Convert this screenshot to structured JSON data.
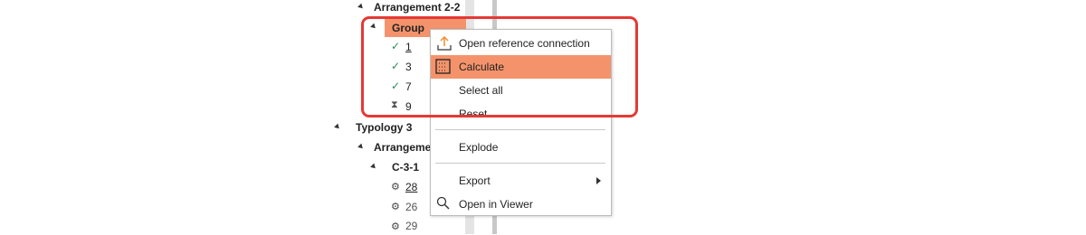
{
  "tree": {
    "arrangement_2_2": "Arrangement 2-2",
    "group": "Group",
    "items": [
      {
        "status": "check",
        "label": "1"
      },
      {
        "status": "check",
        "label": "3"
      },
      {
        "status": "check",
        "label": "7"
      },
      {
        "status": "hourglass",
        "label": "9"
      }
    ],
    "typology_3": "Typology 3",
    "arrangement_3_truncated": "Arrangemen",
    "c_3_1": "C-3-1",
    "sub_items": [
      {
        "status": "gear",
        "label": "28"
      },
      {
        "status": "gear",
        "label": "26"
      },
      {
        "status": "gear",
        "label": "29"
      }
    ]
  },
  "context_menu": {
    "open_reference_connection": "Open reference connection",
    "calculate": "Calculate",
    "select_all": "Select all",
    "reset": "Reset",
    "explode": "Explode",
    "export": "Export",
    "open_in_viewer": "Open in Viewer"
  },
  "colors": {
    "highlight": "#f4936b",
    "annotation_frame": "#e53935",
    "check": "#2e8b57"
  },
  "icons": {
    "open_reference_connection": "upload-arrow-icon",
    "calculate": "calculate-icon",
    "export": "submenu-arrow-icon",
    "open_in_viewer": "search-icon"
  }
}
